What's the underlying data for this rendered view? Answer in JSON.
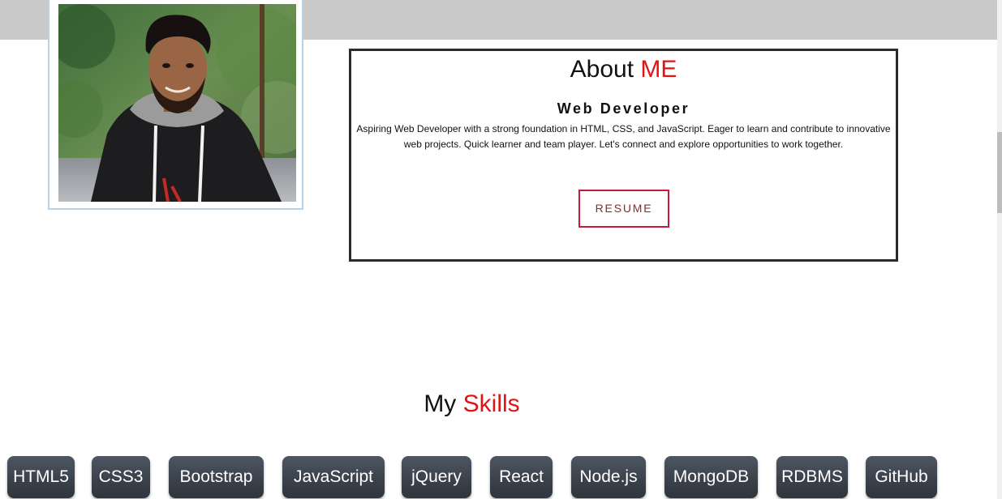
{
  "about": {
    "title_main": "About",
    "title_accent": "ME",
    "role": "Web Developer",
    "description": "Aspiring Web Developer with a strong foundation in HTML, CSS, and JavaScript. Eager to learn and contribute to innovative web projects. Quick learner and team player. Let's connect and explore opportunities to work together.",
    "resume_label": "RESUME"
  },
  "skills": {
    "title_main": "My",
    "title_accent": "Skills",
    "items": [
      "HTML5",
      "CSS3",
      "Bootstrap",
      "JavaScript",
      "jQuery",
      "React",
      "Node.js",
      "MongoDB",
      "RDBMS",
      "GitHub"
    ]
  },
  "colors": {
    "accent_red": "#e01414",
    "resume_border": "#c8183c",
    "skill_chip": "#3b424c",
    "topbar": "#c9c9c9"
  }
}
